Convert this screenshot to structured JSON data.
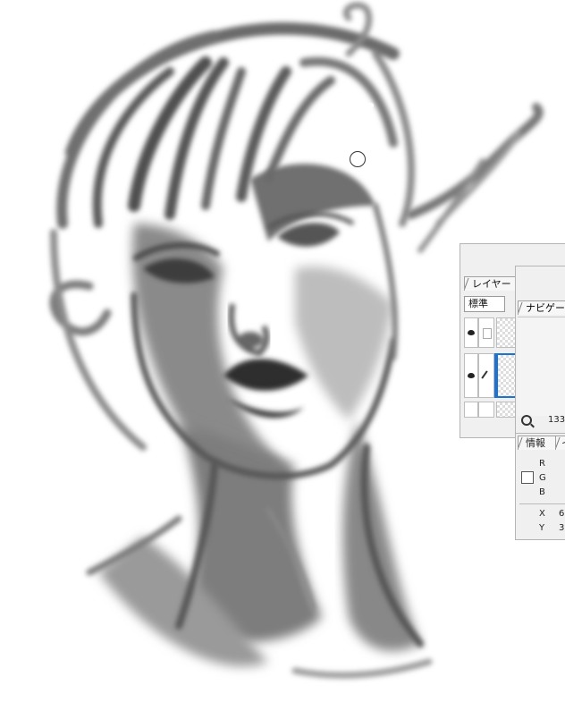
{
  "layer_panel": {
    "tab_label": "レイヤー",
    "blend_mode": "標準"
  },
  "navigator_panel": {
    "tab_label": "ナビゲータ",
    "zoom_value": "133"
  },
  "info_panel": {
    "tab_label": "情報",
    "tab2_label": "イ",
    "r_label": "R",
    "g_label": "G",
    "b_label": "B",
    "x_label": "X",
    "y_label": "Y",
    "x_value": "6",
    "y_value": "3"
  }
}
